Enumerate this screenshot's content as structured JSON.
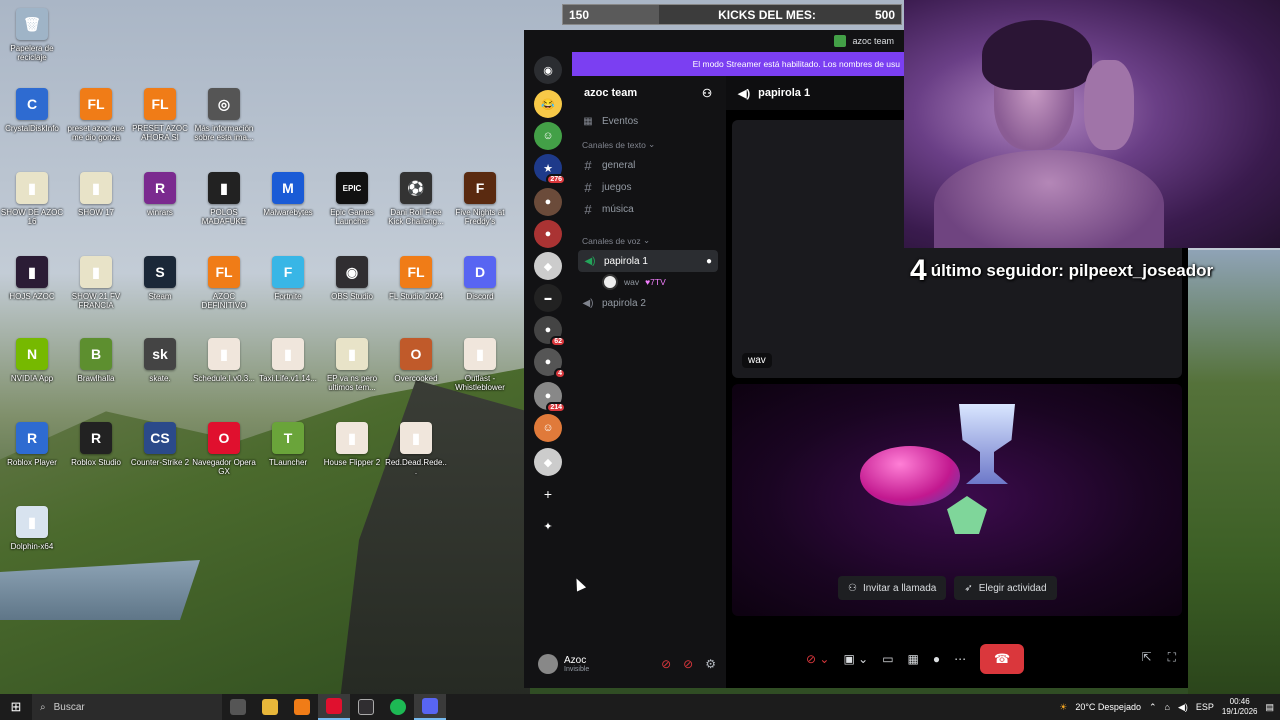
{
  "desktop": {
    "icons": [
      {
        "label": "Papelera de reciclaje",
        "color": "#9fb4c7",
        "glyph": "🗑",
        "icon": "recycle-bin-icon"
      },
      {
        "label": "CrystalDiskInfo",
        "color": "#2e6bd1",
        "glyph": "C",
        "icon": "crystaldiskinfo-icon"
      },
      {
        "label": "preset azoc que me dio gonza",
        "color": "#f07c17",
        "glyph": "FL",
        "icon": "fl-studio-icon"
      },
      {
        "label": "PRESET AZOC AHORA SI",
        "color": "#f07c17",
        "glyph": "FL",
        "icon": "fl-studio-icon"
      },
      {
        "label": "Más información sobre esta ima...",
        "color": "#555",
        "glyph": "◎",
        "icon": "info-camera-icon"
      },
      {
        "label": "SHOW DE AZOC 16",
        "color": "#e8e3c8",
        "glyph": "▮",
        "icon": "project-file-icon"
      },
      {
        "label": "SHOW 17",
        "color": "#e8e3c8",
        "glyph": "▮",
        "icon": "project-file-icon"
      },
      {
        "label": "winrars",
        "color": "#7b2a8f",
        "glyph": "R",
        "icon": "winrar-icon"
      },
      {
        "label": "POLOS MADAFUKE",
        "color": "#222",
        "glyph": "▮",
        "icon": "project-file-icon"
      },
      {
        "label": "Malwarebytes",
        "color": "#1a5bd6",
        "glyph": "M",
        "icon": "malwarebytes-icon"
      },
      {
        "label": "Epic Games Launcher",
        "color": "#111",
        "glyph": "EPIC",
        "icon": "epic-games-icon"
      },
      {
        "label": "Dani Roll Free Kick Challeng...",
        "color": "#333",
        "glyph": "⚽",
        "icon": "football-icon"
      },
      {
        "label": "Five Nights at Freddy's",
        "color": "#5a2a10",
        "glyph": "F",
        "icon": "fnaf-icon"
      },
      {
        "label": "HOJS AZOC",
        "color": "#2b1c35",
        "glyph": "▮",
        "icon": "project-file-icon"
      },
      {
        "label": "SHOW 21 FV FRANCIA",
        "color": "#e8e3c8",
        "glyph": "▮",
        "icon": "project-file-icon"
      },
      {
        "label": "Steam",
        "color": "#1b2838",
        "glyph": "S",
        "icon": "steam-icon"
      },
      {
        "label": "AZOC DEFINITIVO",
        "color": "#f07c17",
        "glyph": "FL",
        "icon": "fl-studio-icon"
      },
      {
        "label": "Fortnite",
        "color": "#38b6e6",
        "glyph": "F",
        "icon": "fortnite-icon"
      },
      {
        "label": "OBS Studio",
        "color": "#302e31",
        "glyph": "◉",
        "icon": "obs-icon"
      },
      {
        "label": "FL Studio 2024",
        "color": "#f07c17",
        "glyph": "FL",
        "icon": "fl-studio-icon"
      },
      {
        "label": "Discord",
        "color": "#5865f2",
        "glyph": "D",
        "icon": "discord-icon"
      },
      {
        "label": "NVIDIA App",
        "color": "#76b900",
        "glyph": "N",
        "icon": "nvidia-icon"
      },
      {
        "label": "Brawlhalla",
        "color": "#5d8f2f",
        "glyph": "B",
        "icon": "brawlhalla-icon"
      },
      {
        "label": "skate.",
        "color": "#444",
        "glyph": "sk",
        "icon": "skate-icon"
      },
      {
        "label": "Schedule.I.v0.3...",
        "color": "#f0e6dc",
        "glyph": "▮",
        "icon": "archive-icon"
      },
      {
        "label": "Taxi.Life.v1.14...",
        "color": "#f0e6dc",
        "glyph": "▮",
        "icon": "archive-icon"
      },
      {
        "label": "EP va ns pero ultimos tem...",
        "color": "#e8e3c8",
        "glyph": "▮",
        "icon": "project-file-icon"
      },
      {
        "label": "Overcooked",
        "color": "#c05a2a",
        "glyph": "O",
        "icon": "overcooked-icon"
      },
      {
        "label": "Outlast - Whistleblower",
        "color": "#f0e6dc",
        "glyph": "▮",
        "icon": "archive-icon"
      },
      {
        "label": "Roblox Player",
        "color": "#2e6bd1",
        "glyph": "R",
        "icon": "roblox-icon"
      },
      {
        "label": "Roblox Studio",
        "color": "#222",
        "glyph": "R",
        "icon": "roblox-studio-icon"
      },
      {
        "label": "Counter-Strike 2",
        "color": "#2b4a8a",
        "glyph": "CS",
        "icon": "counter-strike-icon"
      },
      {
        "label": "Navegador Opera GX",
        "color": "#e0102e",
        "glyph": "O",
        "icon": "opera-gx-icon"
      },
      {
        "label": "TLauncher",
        "color": "#6aa43a",
        "glyph": "T",
        "icon": "tlauncher-icon"
      },
      {
        "label": "House Flipper 2",
        "color": "#f0e6dc",
        "glyph": "▮",
        "icon": "archive-icon"
      },
      {
        "label": "Red.Dead.Rede...",
        "color": "#f0e6dc",
        "glyph": "▮",
        "icon": "archive-icon"
      },
      {
        "label": "Dolphin-x64",
        "color": "#d8e3ef",
        "glyph": "▮",
        "icon": "archive-icon"
      }
    ]
  },
  "kicks": {
    "left": "150",
    "title": "KICKS DEL MES:",
    "right": "500"
  },
  "discord": {
    "titlebar": "azoc team",
    "streamer_banner": "El modo Streamer está habilitado. Los nombres de usu",
    "server_badges": [
      "276",
      "62",
      "4",
      "214"
    ],
    "guild_name": "azoc team",
    "events": "Eventos",
    "text_category": "Canales de texto",
    "text_channels": [
      "general",
      "juegos",
      "música"
    ],
    "voice_category": "Canales de voz",
    "voice_channels": [
      "papirola 1",
      "papirola 2"
    ],
    "voice_member": "wav",
    "voice_member_tag": "♥7TV",
    "voice_header": "papirola 1",
    "tile_label": "wav",
    "invite_btn": "Invitar a llamada",
    "activity_btn": "Elegir actividad",
    "user_name": "Azoc",
    "user_status": "Invisible"
  },
  "overlay": {
    "follower_num": "4",
    "follower_text": "último seguidor: pilpeext_joseador"
  },
  "taskbar": {
    "search": "Buscar",
    "weather": "20°C Despejado",
    "lang": "ESP",
    "time": "00:46",
    "date": "19/1/2026"
  }
}
